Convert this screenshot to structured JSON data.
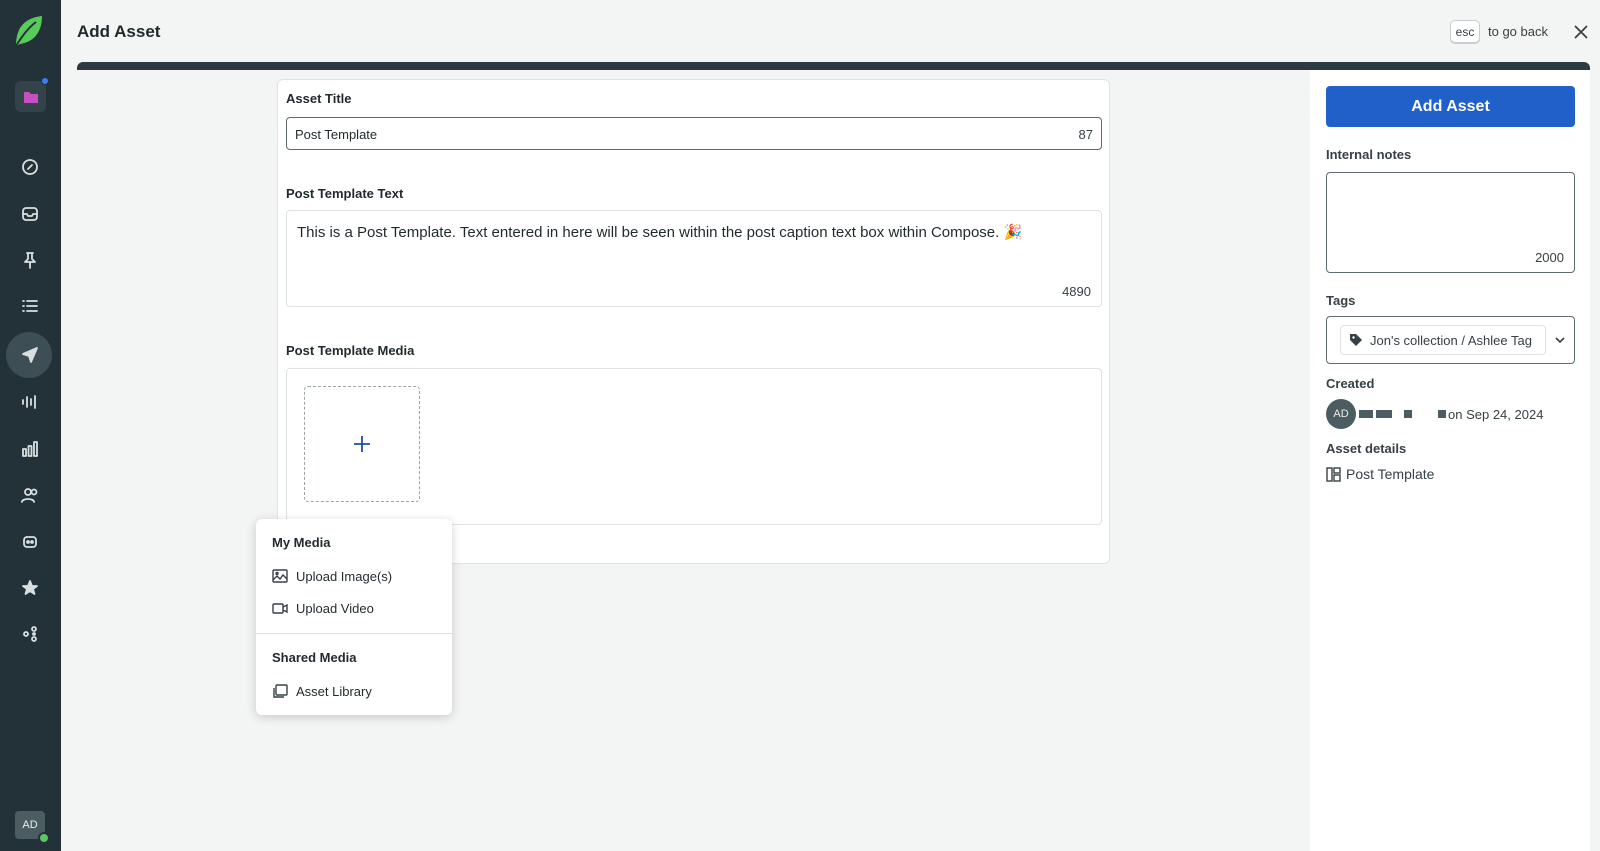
{
  "header": {
    "title": "Add Asset",
    "esc_key": "esc",
    "esc_text": "to go back"
  },
  "sidebar": {
    "avatar_initials": "AD",
    "items": [
      {
        "icon": "folder-icon"
      },
      {
        "icon": "compass-icon"
      },
      {
        "icon": "inbox-icon"
      },
      {
        "icon": "pin-icon"
      },
      {
        "icon": "list-icon"
      },
      {
        "icon": "send-icon"
      },
      {
        "icon": "soundwave-icon"
      },
      {
        "icon": "bar-chart-icon"
      },
      {
        "icon": "people-icon"
      },
      {
        "icon": "bot-icon"
      },
      {
        "icon": "star-icon"
      },
      {
        "icon": "apps-icon"
      }
    ]
  },
  "form": {
    "asset_title_label": "Asset Title",
    "asset_title_value": "Post Template",
    "asset_title_count": "87",
    "text_label": "Post Template Text",
    "text_value": "This is a Post Template. Text entered in here will be seen within the post caption text box within Compose. 🎉",
    "text_count": "4890",
    "media_label": "Post Template Media"
  },
  "menu": {
    "my_media_heading": "My Media",
    "upload_images": "Upload Image(s)",
    "upload_video": "Upload Video",
    "shared_media_heading": "Shared Media",
    "asset_library": "Asset Library"
  },
  "panel": {
    "add_button": "Add Asset",
    "notes_label": "Internal notes",
    "notes_count": "2000",
    "tags_label": "Tags",
    "tag_value": "Jon's collection / Ashlee Tag",
    "created_label": "Created",
    "created_avatar": "AD",
    "created_date": "on Sep 24, 2024",
    "details_label": "Asset details",
    "details_value": "Post Template"
  },
  "colors": {
    "sidebar": "#223238",
    "accent": "#2060c8",
    "brand": "#59cb59"
  }
}
